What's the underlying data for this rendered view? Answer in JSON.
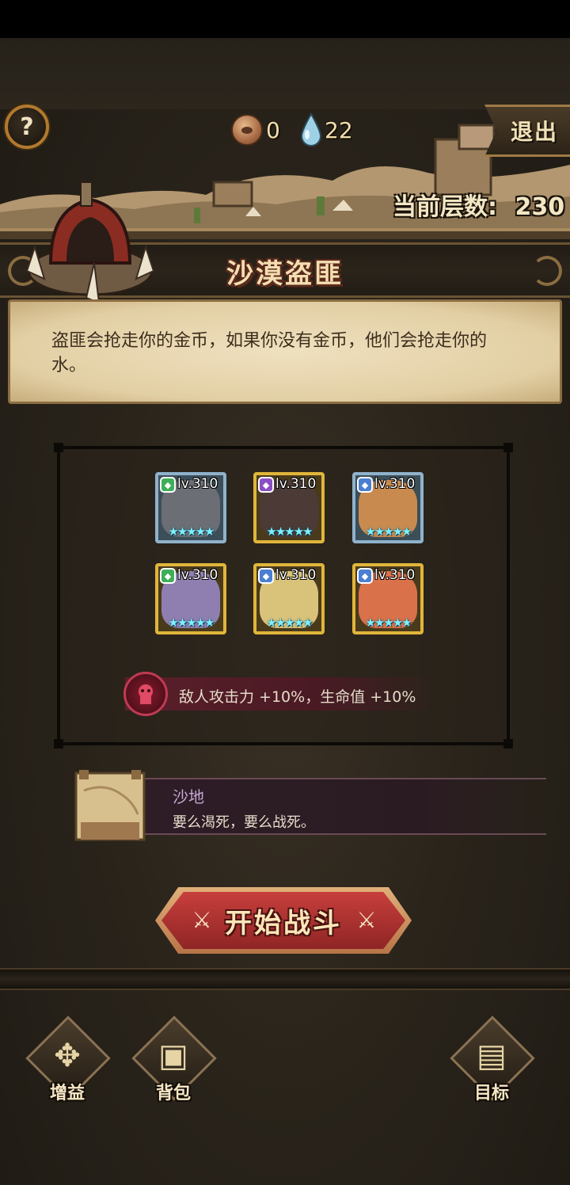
{
  "header": {
    "help_label": "?",
    "coins": "0",
    "water": "22",
    "exit_label": "退出",
    "floor_label": "当前层数:",
    "floor_value": "230"
  },
  "event": {
    "title": "沙漠盗匪",
    "description": "盗匪会抢走你的金币，如果你没有金币，他们会抢走你的水。"
  },
  "enemies": [
    {
      "level": "lv.310",
      "class_color": "#3fae59",
      "frame": "blue",
      "stars": 5,
      "face_color": "#6b6e74"
    },
    {
      "level": "lv.310",
      "class_color": "#8a4fc4",
      "frame": "gold",
      "stars": 5,
      "face_color": "#4b3a35"
    },
    {
      "level": "lv.310",
      "class_color": "#4a7fd1",
      "frame": "blue",
      "stars": 5,
      "face_color": "#c98a4f"
    },
    {
      "level": "lv.310",
      "class_color": "#3fae59",
      "frame": "gold",
      "stars": 5,
      "face_color": "#8f7fb0"
    },
    {
      "level": "lv.310",
      "class_color": "#4a7fd1",
      "frame": "gold",
      "stars": 5,
      "face_color": "#d9c27a"
    },
    {
      "level": "lv.310",
      "class_color": "#4a7fd1",
      "frame": "gold",
      "stars": 5,
      "face_color": "#d9714a"
    }
  ],
  "buff": {
    "text": "敌人攻击力 +10%，生命值 +10%"
  },
  "terrain": {
    "name": "沙地",
    "description": "要么渴死，要么战死。"
  },
  "start_button": {
    "label": "开始战斗"
  },
  "bottom_nav": {
    "buff_label": "增益",
    "bag_label": "背包",
    "goal_label": "目标"
  }
}
